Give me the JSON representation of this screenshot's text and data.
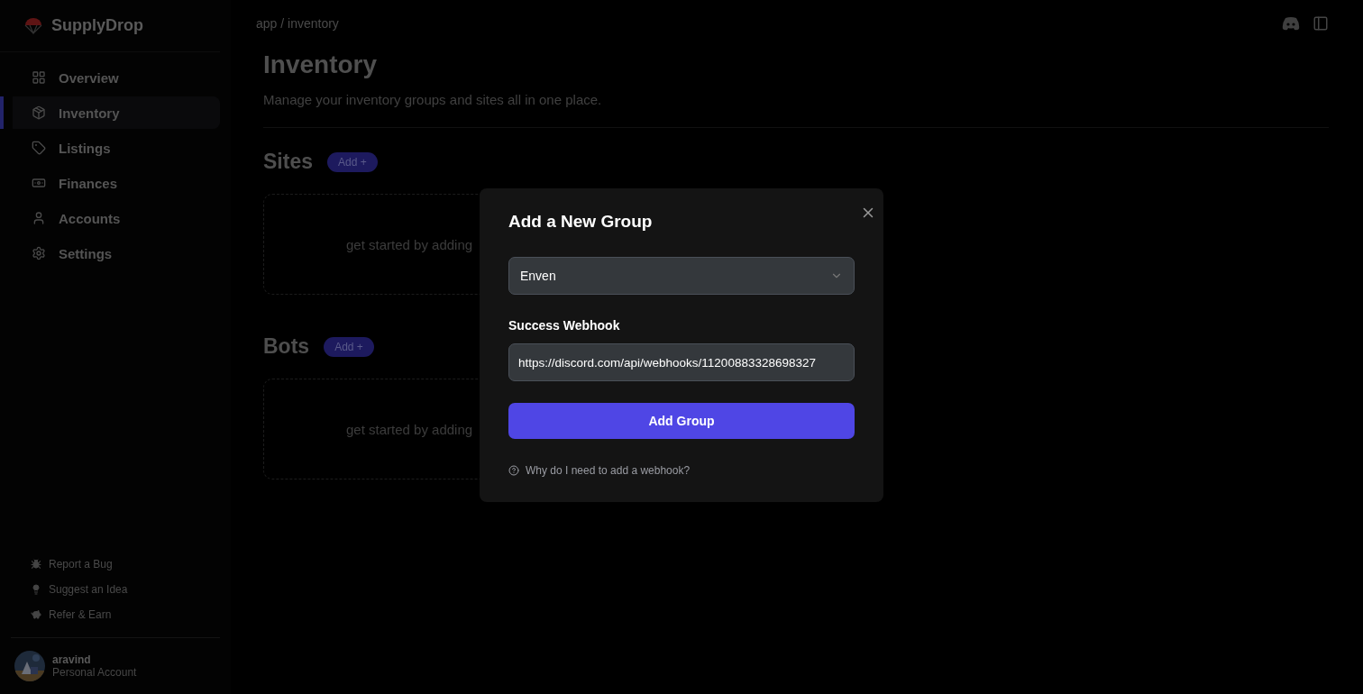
{
  "sidebar": {
    "brand": "SupplyDrop",
    "items": [
      {
        "label": "Overview",
        "kind": "grid",
        "selected": false
      },
      {
        "label": "Inventory",
        "kind": "package",
        "selected": true
      },
      {
        "label": "Listings",
        "kind": "tag",
        "selected": false
      },
      {
        "label": "Finances",
        "kind": "money",
        "selected": false
      },
      {
        "label": "Accounts",
        "kind": "user",
        "selected": false
      },
      {
        "label": "Settings",
        "kind": "gear",
        "selected": false
      }
    ],
    "footer_links": [
      {
        "label": "Report a Bug",
        "kind": "bug"
      },
      {
        "label": "Suggest an Idea",
        "kind": "bulb"
      },
      {
        "label": "Refer & Earn",
        "kind": "piggy"
      }
    ],
    "user": {
      "name": "aravind",
      "account": "Personal Account"
    }
  },
  "breadcrumb": "app / inventory",
  "page": {
    "title": "Inventory",
    "subtitle": "Manage your inventory groups and sites all in one place.",
    "sections": [
      {
        "title": "Sites",
        "add_label": "Add +",
        "empty_text": "get started by adding"
      },
      {
        "title": "Bots",
        "add_label": "Add +",
        "empty_text": "get started by adding"
      }
    ]
  },
  "modal": {
    "title": "Add a New Group",
    "select_value": "Enven",
    "field_label": "Success Webhook",
    "field_value": "https://discord.com/api/webhooks/11200883328698327",
    "button": "Add Group",
    "help": "Why do I need to add a webhook?"
  }
}
